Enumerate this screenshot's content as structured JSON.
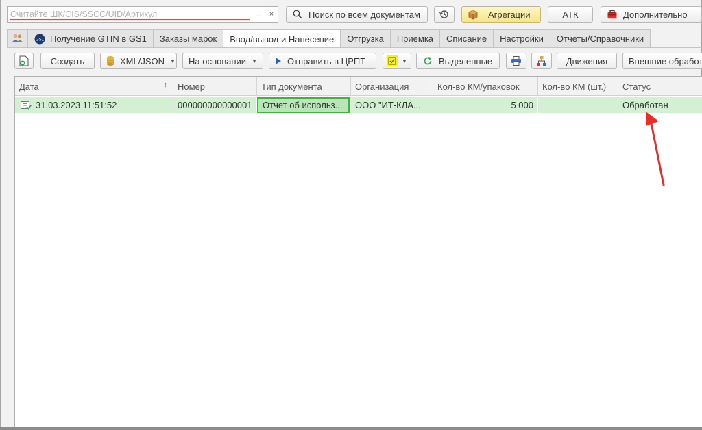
{
  "search": {
    "placeholder": "Считайте ШК/CIS/SSCC/UID/Артикул",
    "more_label": "...",
    "clear_label": "×"
  },
  "top_buttons": {
    "search_all": "Поиск по всем документам",
    "aggregation": "Агрегации",
    "atk": "АТК",
    "additional": "Дополнительно"
  },
  "tabs": [
    {
      "label": "",
      "icon": "users-icon"
    },
    {
      "label": "Получение GTIN в GS1",
      "icon": "gs1-logo-icon"
    },
    {
      "label": "Заказы марок"
    },
    {
      "label": "Ввод/вывод и Нанесение",
      "active": true
    },
    {
      "label": "Отгрузка"
    },
    {
      "label": "Приемка"
    },
    {
      "label": "Списание"
    },
    {
      "label": "Настройки"
    },
    {
      "label": "Отчеты/Справочники"
    }
  ],
  "toolbar": {
    "create": "Создать",
    "xml_json": "XML/JSON",
    "based_on": "На основании",
    "send": "Отправить в ЦРПТ",
    "selected": "Выделенные",
    "movements": "Движения",
    "external": "Внешние обработки"
  },
  "table": {
    "columns": [
      "Дата",
      "Номер",
      "Тип документа",
      "Организация",
      "Кол-во КМ/упаковок",
      "Кол-во КМ (шт.)",
      "Статус"
    ],
    "sort_indicator": "↑",
    "rows": [
      {
        "date": "31.03.2023 11:51:52",
        "number": "000000000000001",
        "doc_type": "Отчет об использ...",
        "org": "ООО \"ИТ-КЛА...",
        "qty_packs": "5 000",
        "qty_pcs": "",
        "status": "Обработан"
      }
    ]
  },
  "colors": {
    "row_highlight": "#d3f0d3",
    "focused_cell_border": "#45b045",
    "annotation_arrow": "#e0322a"
  }
}
